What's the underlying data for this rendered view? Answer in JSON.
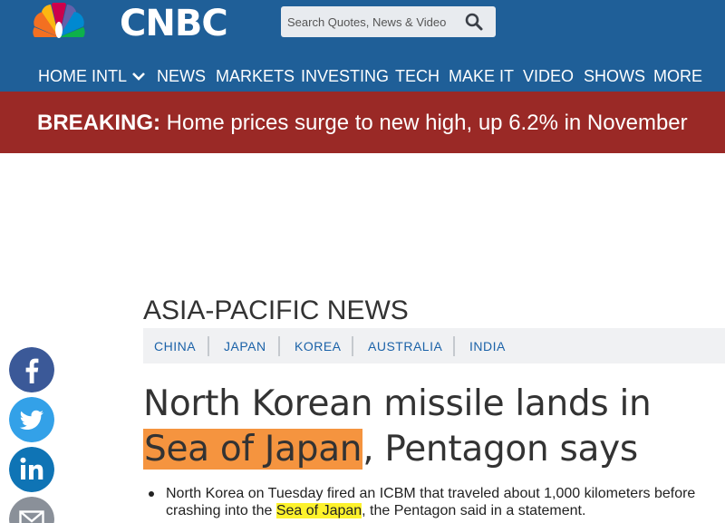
{
  "header": {
    "logo_text": "CNBC",
    "search": {
      "placeholder": "Search Quotes, News & Video"
    }
  },
  "nav": {
    "items": [
      {
        "label": "HOME INTL"
      },
      {
        "label": "NEWS"
      },
      {
        "label": "MARKETS"
      },
      {
        "label": "INVESTING"
      },
      {
        "label": "TECH"
      },
      {
        "label": "MAKE IT"
      },
      {
        "label": "VIDEO"
      },
      {
        "label": "SHOWS"
      },
      {
        "label": "MORE"
      }
    ]
  },
  "breaking": {
    "prefix": "BREAKING:",
    "text": " Home prices surge to new high, up 6.2% in November"
  },
  "article": {
    "section": "ASIA-PACIFIC NEWS",
    "tags": [
      "CHINA",
      "JAPAN",
      "KOREA",
      "AUSTRALIA",
      "INDIA"
    ],
    "headline": {
      "highlight": "Sea of Japan",
      "line1": "North Korean missile lands in ",
      "rest": ", Pentagon says"
    },
    "bullet": {
      "before": "North Korea on Tuesday fired an ICBM that traveled about 1,000 kilometers before crashing into the ",
      "highlight": "Sea of Japan",
      "after": ", the Pentagon said in a statement."
    }
  },
  "social": {
    "icons": [
      "facebook-icon",
      "twitter-icon",
      "linkedin-icon",
      "email-icon"
    ]
  },
  "colors": {
    "header_blue": "#1f5f98",
    "breaking_red": "#9a2926",
    "tag_blue": "#1b62a8",
    "headline_highlight": "#f5943f",
    "text_highlight": "#fdf22c",
    "facebook": "#3b5998",
    "twitter": "#33a1e8",
    "linkedin": "#0f74b5"
  }
}
